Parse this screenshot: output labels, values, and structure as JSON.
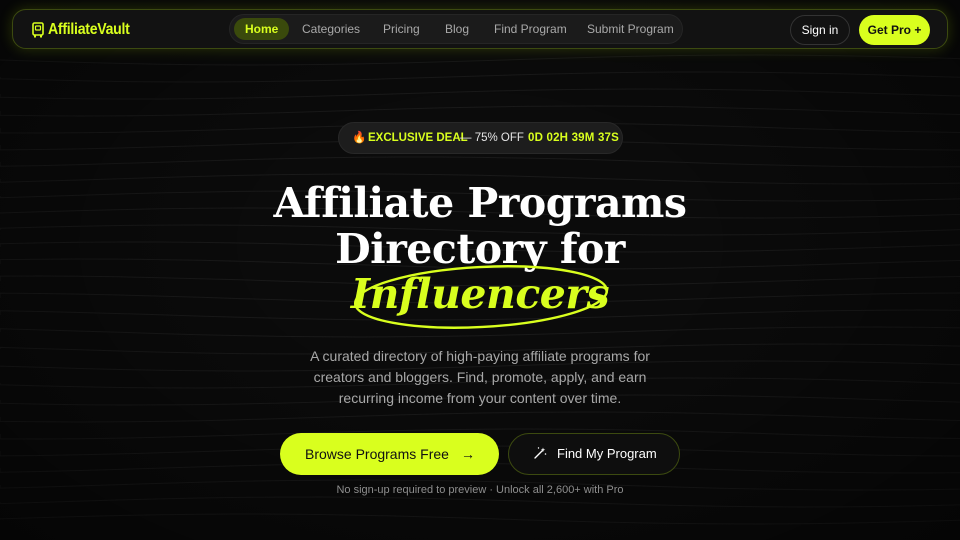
{
  "brand": {
    "name": "AffiliateVault",
    "accent": "#d9ff1e"
  },
  "nav": {
    "items": [
      {
        "label": "Home",
        "active": true
      },
      {
        "label": "Categories"
      },
      {
        "label": "Pricing"
      },
      {
        "label": "Blog"
      },
      {
        "label": "Find Program"
      },
      {
        "label": "Submit Program"
      }
    ],
    "signin": "Sign in",
    "getpro": "Get Pro +"
  },
  "deal": {
    "icon": "fire-icon",
    "title": "EXCLUSIVE DEAL",
    "offer": "— 75% OFF",
    "timer": "0D 02H 39M 37S"
  },
  "hero": {
    "line1": "Affiliate Programs",
    "line2": "Directory for",
    "highlight": "Influencers",
    "subtitle_lines": [
      "A curated directory of high-paying affiliate programs for",
      "creators and bloggers. Find, promote, apply, and earn",
      "recurring income from your content over time."
    ]
  },
  "cta": {
    "primary": "Browse Programs Free",
    "primary_icon": "arrow-right-icon",
    "secondary": "Find My Program",
    "secondary_icon": "magic-wand-icon",
    "note": "No sign-up required to preview · Unlock all 2,600+ with Pro"
  }
}
